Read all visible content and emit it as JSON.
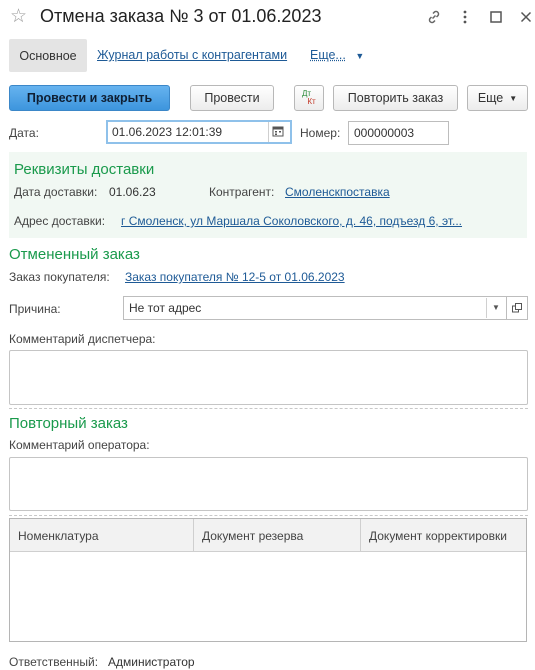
{
  "window": {
    "title": "Отмена заказа № 3 от 01.06.2023"
  },
  "nav": {
    "main_tab": "Основное",
    "journal_link": "Журнал работы с контрагентами",
    "more": "Еще..."
  },
  "toolbar": {
    "post_close": "Провести и закрыть",
    "post": "Провести",
    "dtkt_dt": "Дт",
    "dtkt_kt": "Кт",
    "repeat_order": "Повторить заказ",
    "more": "Еще"
  },
  "header": {
    "date_label": "Дата:",
    "date_value": "01.06.2023 12:01:39",
    "number_label": "Номер:",
    "number_value": "000000003"
  },
  "delivery": {
    "section_title": "Реквизиты доставки",
    "date_label": "Дата доставки:",
    "date_value": "01.06.23",
    "contractor_label": "Контрагент:",
    "contractor_value": "Смоленскпоставка",
    "address_label": "Адрес доставки:",
    "address_value": "г Смоленск,  ул Маршала Соколовского,  д. 46,  подъезд 6,  эт..."
  },
  "cancelled": {
    "section_title": "Отмененный заказ",
    "order_label": "Заказ покупателя:",
    "order_value": "Заказ покупателя № 12-5 от 01.06.2023",
    "reason_label": "Причина:",
    "reason_value": "Не тот адрес",
    "dispatcher_comment_label": "Комментарий диспетчера:"
  },
  "repeat": {
    "section_title": "Повторный заказ",
    "operator_comment_label": "Комментарий оператора:"
  },
  "table": {
    "columns": [
      "Номенклатура",
      "Документ резерва",
      "Документ корректировки"
    ]
  },
  "footer": {
    "responsible_label": "Ответственный:",
    "responsible_value": "Администратор"
  },
  "colors": {
    "accent_green": "#1a9a4c",
    "link_blue": "#1e5a96",
    "primary_button": "#4aa0e4"
  }
}
